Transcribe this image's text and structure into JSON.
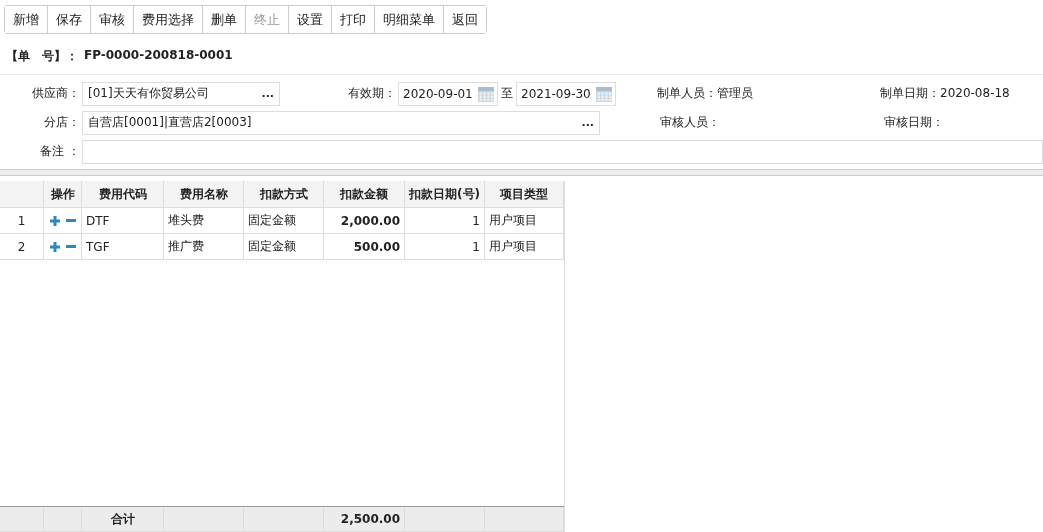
{
  "toolbar": [
    {
      "label": "新增",
      "disabled": false
    },
    {
      "label": "保存",
      "disabled": false
    },
    {
      "label": "审核",
      "disabled": false
    },
    {
      "label": "费用选择",
      "disabled": false
    },
    {
      "label": "删单",
      "disabled": false
    },
    {
      "label": "终止",
      "disabled": true
    },
    {
      "label": "设置",
      "disabled": false
    },
    {
      "label": "打印",
      "disabled": false
    },
    {
      "label": "明细菜单",
      "disabled": false
    },
    {
      "label": "返回",
      "disabled": false
    }
  ],
  "doc_number": {
    "label": "【单　号】：",
    "value": "FP-0000-200818-0001"
  },
  "form": {
    "supplier": {
      "label": "供应商：",
      "value": "[01]天天有你贸易公司",
      "button": "..."
    },
    "validity": {
      "label": "有效期：",
      "from": "2020-09-01",
      "separator": "至",
      "to": "2021-09-30"
    },
    "creator": {
      "label": "制单人员：",
      "value": "管理员"
    },
    "created_date": {
      "label": "制单日期：",
      "value": "2020-08-18"
    },
    "store": {
      "label": "分店：",
      "value": "自营店[0001]|直营店2[0003]",
      "button": "..."
    },
    "reviewer": {
      "label": "审核人员："
    },
    "review_date": {
      "label": "审核日期："
    },
    "remark": {
      "label": "备注 ："
    }
  },
  "table": {
    "columns": [
      "操作",
      "费用代码",
      "费用名称",
      "扣款方式",
      "扣款金额",
      "扣款日期(号)",
      "项目类型"
    ],
    "rows": [
      {
        "index": "1",
        "code": "DTF",
        "name": "堆头费",
        "method": "固定金额",
        "amount": "2,000.00",
        "day": "1",
        "type": "用户项目"
      },
      {
        "index": "2",
        "code": "TGF",
        "name": "推广费",
        "method": "固定金额",
        "amount": "500.00",
        "day": "1",
        "type": "用户项目"
      }
    ],
    "footer": {
      "label": "合计",
      "amount": "2,500.00"
    }
  }
}
